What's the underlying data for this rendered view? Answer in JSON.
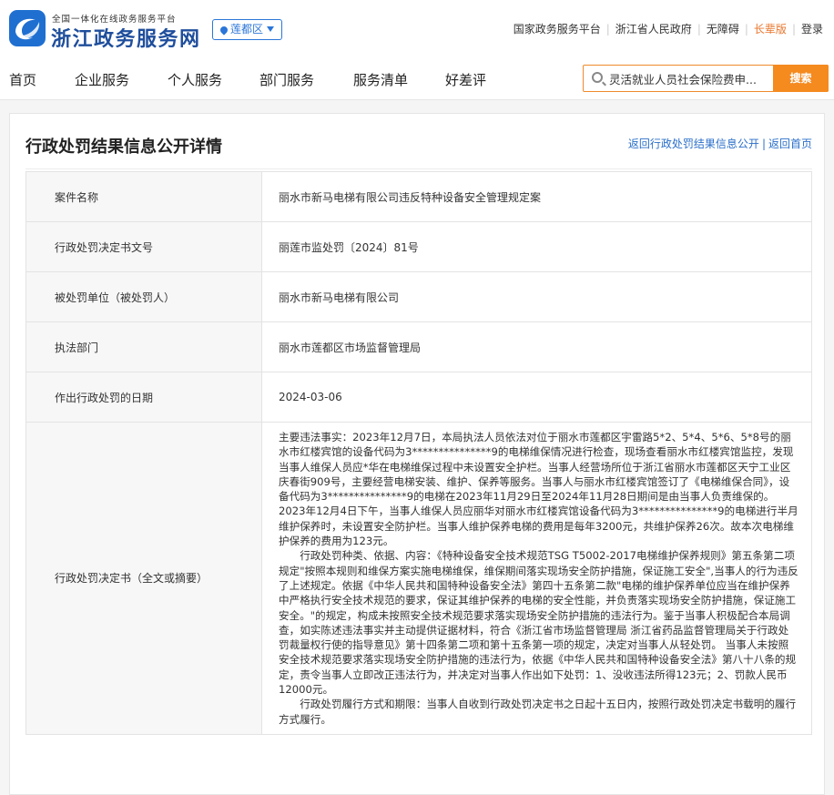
{
  "header": {
    "logo_sub": "全国一体化在线政务服务平台",
    "logo_title": "浙江政务服务网",
    "region": "莲都区",
    "top_links": [
      "国家政务服务平台",
      "浙江省人民政府",
      "无障碍",
      "长辈版",
      "登录"
    ]
  },
  "nav": {
    "items": [
      "首页",
      "企业服务",
      "个人服务",
      "部门服务",
      "服务清单",
      "好差评"
    ]
  },
  "search": {
    "value": "灵活就业人员社会保险费申...",
    "button": "搜索"
  },
  "page": {
    "title": "行政处罚结果信息公开详情",
    "link_back_list": "返回行政处罚结果信息公开",
    "link_home": "返回首页"
  },
  "details": {
    "rows": [
      {
        "label": "案件名称",
        "value": "丽水市新马电梯有限公司违反特种设备安全管理规定案"
      },
      {
        "label": "行政处罚决定书文号",
        "value": "丽莲市监处罚〔2024〕81号"
      },
      {
        "label": "被处罚单位（被处罚人）",
        "value": "丽水市新马电梯有限公司"
      },
      {
        "label": "执法部门",
        "value": "丽水市莲都区市场监督管理局"
      },
      {
        "label": "作出行政处罚的日期",
        "value": "2024-03-06"
      }
    ],
    "summary_label": "行政处罚决定书（全文或摘要）",
    "summary_p1": "主要违法事实：2023年12月7日，本局执法人员依法对位于丽水市莲都区宇雷路5*2、5*4、5*6、5*8号的丽水市红楼宾馆的设备代码为3***************9的电梯维保情况进行检查，现场查看丽水市红楼宾馆监控，发现当事人维保人员应*华在电梯维保过程中未设置安全护栏。当事人经营场所位于浙江省丽水市莲都区天宁工业区庆春街909号，主要经营电梯安装、维护、保养等服务。当事人与丽水市红楼宾馆签订了《电梯维保合同》，设备代码为3***************9的电梯在2023年11月29日至2024年11月28日期间是由当事人负责维保的。2023年12月4日下午，当事人维保人员应丽华对丽水市红楼宾馆设备代码为3***************9的电梯进行半月维护保养时，未设置安全防护栏。当事人维护保养电梯的费用是每年3200元，共维护保养26次。故本次电梯维护保养的费用为123元。",
    "summary_p2": "行政处罚种类、依据、内容：《特种设备安全技术规范TSG T5002-2017电梯维护保养规则》第五条第二项规定\"按照本规则和维保方案实施电梯维保，维保期间落实现场安全防护措施，保证施工安全\",当事人的行为违反了上述规定。依据《中华人民共和国特种设备安全法》第四十五条第二款\"电梯的维护保养单位应当在维护保养中严格执行安全技术规范的要求，保证其维护保养的电梯的安全性能，并负责落实现场安全防护措施，保证施工安全。\"的规定，构成未按照安全技术规范要求落实现场安全防护措施的违法行为。鉴于当事人积极配合本局调查，如实陈述违法事实并主动提供证据材料，符合《浙江省市场监督管理局 浙江省药品监督管理局关于行政处罚裁量权行使的指导意见》第十四条第二项和第十五条第一项的规定，决定对当事人从轻处罚。    当事人未按照安全技术规范要求落实现场安全防护措施的违法行为，依据《中华人民共和国特种设备安全法》第八十八条的规定，责令当事人立即改正违法行为，并决定对当事人作出如下处罚：1、没收违法所得123元；2、罚款人民币12000元。",
    "summary_p3": "行政处罚履行方式和期限：当事人自收到行政处罚决定书之日起十五日内，按照行政处罚决定书载明的履行方式履行。"
  }
}
